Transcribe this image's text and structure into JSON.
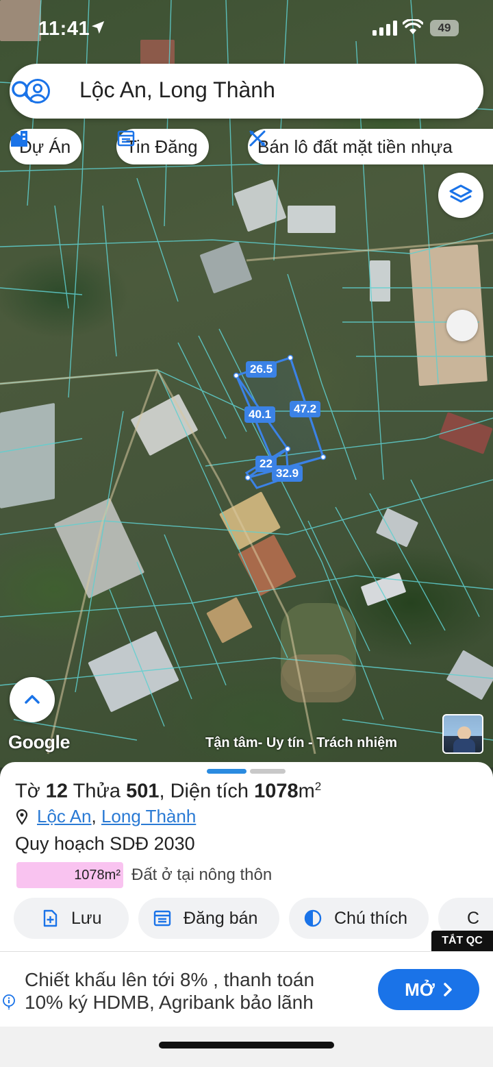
{
  "status_bar": {
    "time": "11:41",
    "battery": "49"
  },
  "search": {
    "query": "Lộc An, Long Thành"
  },
  "chips": [
    {
      "label": "Dự Án",
      "icon": "building-icon"
    },
    {
      "label": "Tin Đăng",
      "icon": "listing-icon"
    },
    {
      "label": "Bán lô đất mặt tiền nhựa",
      "icon": "ruler-pencil-icon"
    }
  ],
  "map": {
    "measurements": {
      "top": "26.5",
      "left": "40.1",
      "right": "47.2",
      "short": "22",
      "bottom": "32.9"
    },
    "attribution": "Google",
    "watermark": "Tận tâm- Uy tín - Trách nhiệm",
    "boundary_color": "#5fd0d0",
    "highlight_color": "#3b82e6"
  },
  "parcel": {
    "title_prefix": "Tờ",
    "sheet_no": "12",
    "title_mid": "Thửa",
    "parcel_no": "501",
    "title_area_label": ", Diện tích",
    "area": "1078",
    "area_unit": "m",
    "area_sup": "2",
    "ward": "Lộc An",
    "district": "Long Thành",
    "plan": "Quy hoạch SDĐ 2030",
    "landuse_value": "1078m²",
    "landuse_label": "Đất ở tại nông thôn",
    "landuse_color": "#f9c3f0"
  },
  "actions": [
    {
      "label": "Lưu",
      "icon": "save-icon"
    },
    {
      "label": "Đăng bán",
      "icon": "post-icon"
    },
    {
      "label": "Chú thích",
      "icon": "legend-icon"
    },
    {
      "label": "C",
      "icon": "camera-icon"
    }
  ],
  "ad": {
    "hide_label": "TẮT QC",
    "line1": "Chiết khấu lên tới 8% , thanh toán",
    "line2": "10% ký HDMB, Agribank bảo lãnh",
    "cta": "MỞ"
  }
}
